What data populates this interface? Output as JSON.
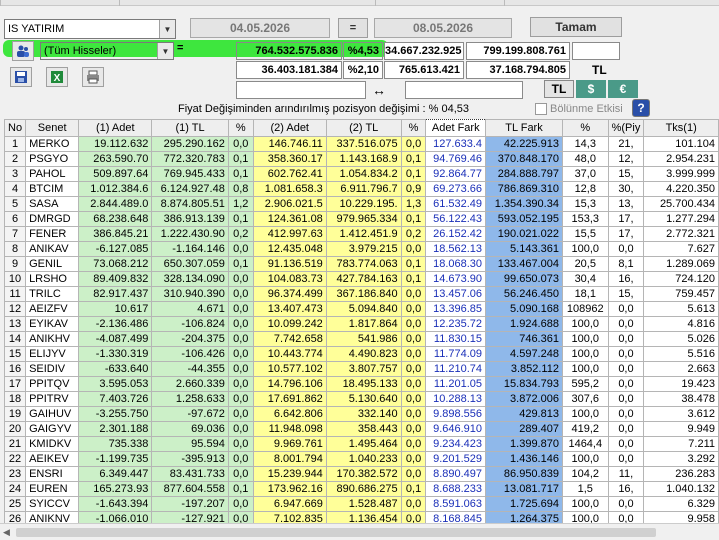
{
  "toolbar": {
    "broker": "IS YATIRIM",
    "stock_filter": "(Tüm Hisseler)",
    "date_from": "04.05.2026",
    "equals": "=",
    "date_to": "08.05.2026",
    "ok_button": "Tamam",
    "row1_eq": "=",
    "row1_val1": "764.532.575.836",
    "row1_pct": "%4,53",
    "row1_val2": "34.667.232.925",
    "row1_val3": "799.199.808.761",
    "row2_val1": "36.403.181.384",
    "row2_pct": "%2,10",
    "row2_val2": "765.613.421",
    "row2_val3": "37.168.794.805",
    "row2_unit": "TL",
    "arrow": "↔",
    "cur_tl": "TL",
    "cur_usd": "$",
    "cur_eur": "€",
    "info_text": "Fiyat Değişiminden arındırılmış pozisyon değişimi : % 04,53",
    "bolunme_label": "Bölünme Etkisi",
    "help": "?"
  },
  "icons": {
    "save": "save-icon",
    "excel": "excel-icon",
    "print": "print-icon",
    "filter": "people-icon"
  },
  "colors": {
    "highlight": "#3ee63e",
    "green_col": "#ccf0c8",
    "yellow_col": "#ffff99",
    "blue_col": "#8fb8ea",
    "blue_text": "#1a2fb8"
  },
  "table": {
    "headers": [
      "No",
      "Senet",
      "(1) Adet",
      "(1) TL",
      "%",
      "(2) Adet",
      "(2) TL",
      "%",
      "Adet Fark",
      "TL Fark",
      "%",
      "%(Piy",
      "Tks(1)"
    ],
    "rows": [
      [
        "1",
        "MERKO",
        "19.112.632",
        "295.290.162",
        "0,0",
        "146.746.11",
        "337.516.075",
        "0,0",
        "127.633.4",
        "42.225.913",
        "14,3",
        "21,",
        "101.104"
      ],
      [
        "2",
        "PSGYO",
        "263.590.70",
        "772.320.783",
        "0,1",
        "358.360.17",
        "1.143.168.9",
        "0,1",
        "94.769.46",
        "370.848.170",
        "48,0",
        "12,",
        "2.954.231"
      ],
      [
        "3",
        "PAHOL",
        "509.897.64",
        "769.945.433",
        "0,1",
        "602.762.41",
        "1.054.834.2",
        "0,1",
        "92.864.77",
        "284.888.797",
        "37,0",
        "15,",
        "3.999.999"
      ],
      [
        "4",
        "BTCIM",
        "1.012.384.6",
        "6.124.927.48",
        "0,8",
        "1.081.658.3",
        "6.911.796.7",
        "0,9",
        "69.273.66",
        "786.869.310",
        "12,8",
        "30,",
        "4.220.350"
      ],
      [
        "5",
        "SASA",
        "2.844.489.0",
        "8.874.805.51",
        "1,2",
        "2.906.021.5",
        "10.229.195.",
        "1,3",
        "61.532.49",
        "1.354.390.34",
        "15,3",
        "13,",
        "25.700.434"
      ],
      [
        "6",
        "DMRGD",
        "68.238.648",
        "386.913.139",
        "0,1",
        "124.361.08",
        "979.965.334",
        "0,1",
        "56.122.43",
        "593.052.195",
        "153,3",
        "17,",
        "1.277.294"
      ],
      [
        "7",
        "FENER",
        "386.845.21",
        "1.222.430.90",
        "0,2",
        "412.997.63",
        "1.412.451.9",
        "0,2",
        "26.152.42",
        "190.021.022",
        "15,5",
        "17,",
        "2.772.321"
      ],
      [
        "8",
        "ANIKAV",
        "-6.127.085",
        "-1.164.146",
        "0,0",
        "12.435.048",
        "3.979.215",
        "0,0",
        "18.562.13",
        "5.143.361",
        "100,0",
        "0,0",
        "7.627"
      ],
      [
        "9",
        "GENIL",
        "73.068.212",
        "650.307.059",
        "0,1",
        "91.136.519",
        "783.774.063",
        "0,1",
        "18.068.30",
        "133.467.004",
        "20,5",
        "8,1",
        "1.289.069"
      ],
      [
        "10",
        "LRSHO",
        "89.409.832",
        "328.134.090",
        "0,0",
        "104.083.73",
        "427.784.163",
        "0,1",
        "14.673.90",
        "99.650.073",
        "30,4",
        "16,",
        "724.120"
      ],
      [
        "11",
        "TRILC",
        "82.917.437",
        "310.940.390",
        "0,0",
        "96.374.499",
        "367.186.840",
        "0,0",
        "13.457.06",
        "56.246.450",
        "18,1",
        "15,",
        "759.457"
      ],
      [
        "12",
        "AEIZFV",
        "10.617",
        "4.671",
        "0,0",
        "13.407.473",
        "5.094.840",
        "0,0",
        "13.396.85",
        "5.090.168",
        "108962",
        "0,0",
        "5.613"
      ],
      [
        "13",
        "EYIKAV",
        "-2.136.486",
        "-106.824",
        "0,0",
        "10.099.242",
        "1.817.864",
        "0,0",
        "12.235.72",
        "1.924.688",
        "100,0",
        "0,0",
        "4.816"
      ],
      [
        "14",
        "ANIKHV",
        "-4.087.499",
        "-204.375",
        "0,0",
        "7.742.658",
        "541.986",
        "0,0",
        "11.830.15",
        "746.361",
        "100,0",
        "0,0",
        "5.026"
      ],
      [
        "15",
        "ELIJYV",
        "-1.330.319",
        "-106.426",
        "0,0",
        "10.443.774",
        "4.490.823",
        "0,0",
        "11.774.09",
        "4.597.248",
        "100,0",
        "0,0",
        "5.516"
      ],
      [
        "16",
        "SEIDIV",
        "-633.640",
        "-44.355",
        "0,0",
        "10.577.102",
        "3.807.757",
        "0,0",
        "11.210.74",
        "3.852.112",
        "100,0",
        "0,0",
        "2.663"
      ],
      [
        "17",
        "PPITQV",
        "3.595.053",
        "2.660.339",
        "0,0",
        "14.796.106",
        "18.495.133",
        "0,0",
        "11.201.05",
        "15.834.793",
        "595,2",
        "0,0",
        "19.423"
      ],
      [
        "18",
        "PPITRV",
        "7.403.726",
        "1.258.633",
        "0,0",
        "17.691.862",
        "5.130.640",
        "0,0",
        "10.288.13",
        "3.872.006",
        "307,6",
        "0,0",
        "38.478"
      ],
      [
        "19",
        "GAIHUV",
        "-3.255.750",
        "-97.672",
        "0,0",
        "6.642.806",
        "332.140",
        "0,0",
        "9.898.556",
        "429.813",
        "100,0",
        "0,0",
        "3.612"
      ],
      [
        "20",
        "GAIGYV",
        "2.301.188",
        "69.036",
        "0,0",
        "11.948.098",
        "358.443",
        "0,0",
        "9.646.910",
        "289.407",
        "419,2",
        "0,0",
        "9.949"
      ],
      [
        "21",
        "KMIDKV",
        "735.338",
        "95.594",
        "0,0",
        "9.969.761",
        "1.495.464",
        "0,0",
        "9.234.423",
        "1.399.870",
        "1464,4",
        "0,0",
        "7.211"
      ],
      [
        "22",
        "AEIKEV",
        "-1.199.735",
        "-395.913",
        "0,0",
        "8.001.794",
        "1.040.233",
        "0,0",
        "9.201.529",
        "1.436.146",
        "100,0",
        "0,0",
        "3.292"
      ],
      [
        "23",
        "ENSRI",
        "6.349.447",
        "83.431.733",
        "0,0",
        "15.239.944",
        "170.382.572",
        "0,0",
        "8.890.497",
        "86.950.839",
        "104,2",
        "11,",
        "236.283"
      ],
      [
        "24",
        "EUREN",
        "165.273.93",
        "877.604.558",
        "0,1",
        "173.962.16",
        "890.686.275",
        "0,1",
        "8.688.233",
        "13.081.717",
        "1,5",
        "16,",
        "1.040.132"
      ],
      [
        "25",
        "SYICCV",
        "-1.643.394",
        "-197.207",
        "0,0",
        "6.947.669",
        "1.528.487",
        "0,0",
        "8.591.063",
        "1.725.694",
        "100,0",
        "0,0",
        "6.329"
      ],
      [
        "26",
        "ANIKNV",
        "-1.066.010",
        "-127.921",
        "0,0",
        "7.102.835",
        "1.136.454",
        "0,0",
        "8.168.845",
        "1.264.375",
        "100,0",
        "0,0",
        "9.958"
      ]
    ]
  }
}
